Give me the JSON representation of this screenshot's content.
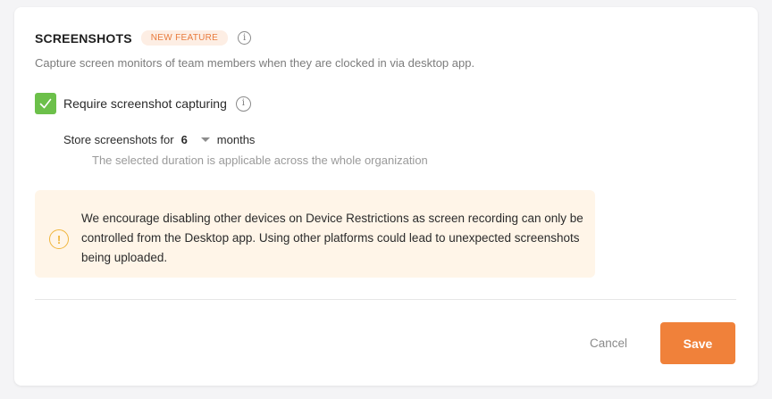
{
  "section": {
    "title": "SCREENSHOTS",
    "badge": "NEW FEATURE",
    "description": "Capture screen monitors of team members when they are clocked in via desktop app."
  },
  "require_capture": {
    "label": "Require screenshot capturing",
    "checked": true,
    "check_color": "#6cc04a"
  },
  "retention": {
    "prefix": "Store screenshots for",
    "value": "6",
    "unit": "months",
    "hint": "The selected duration is applicable across the whole organization"
  },
  "alert": {
    "icon": "warning-circle-icon",
    "text": "We encourage disabling other devices on Device Restrictions as screen recording can only be controlled from the Desktop app. Using other platforms could lead to unexpected screenshots being uploaded."
  },
  "actions": {
    "cancel_label": "Cancel",
    "save_label": "Save",
    "accent_color": "#f0813a"
  }
}
